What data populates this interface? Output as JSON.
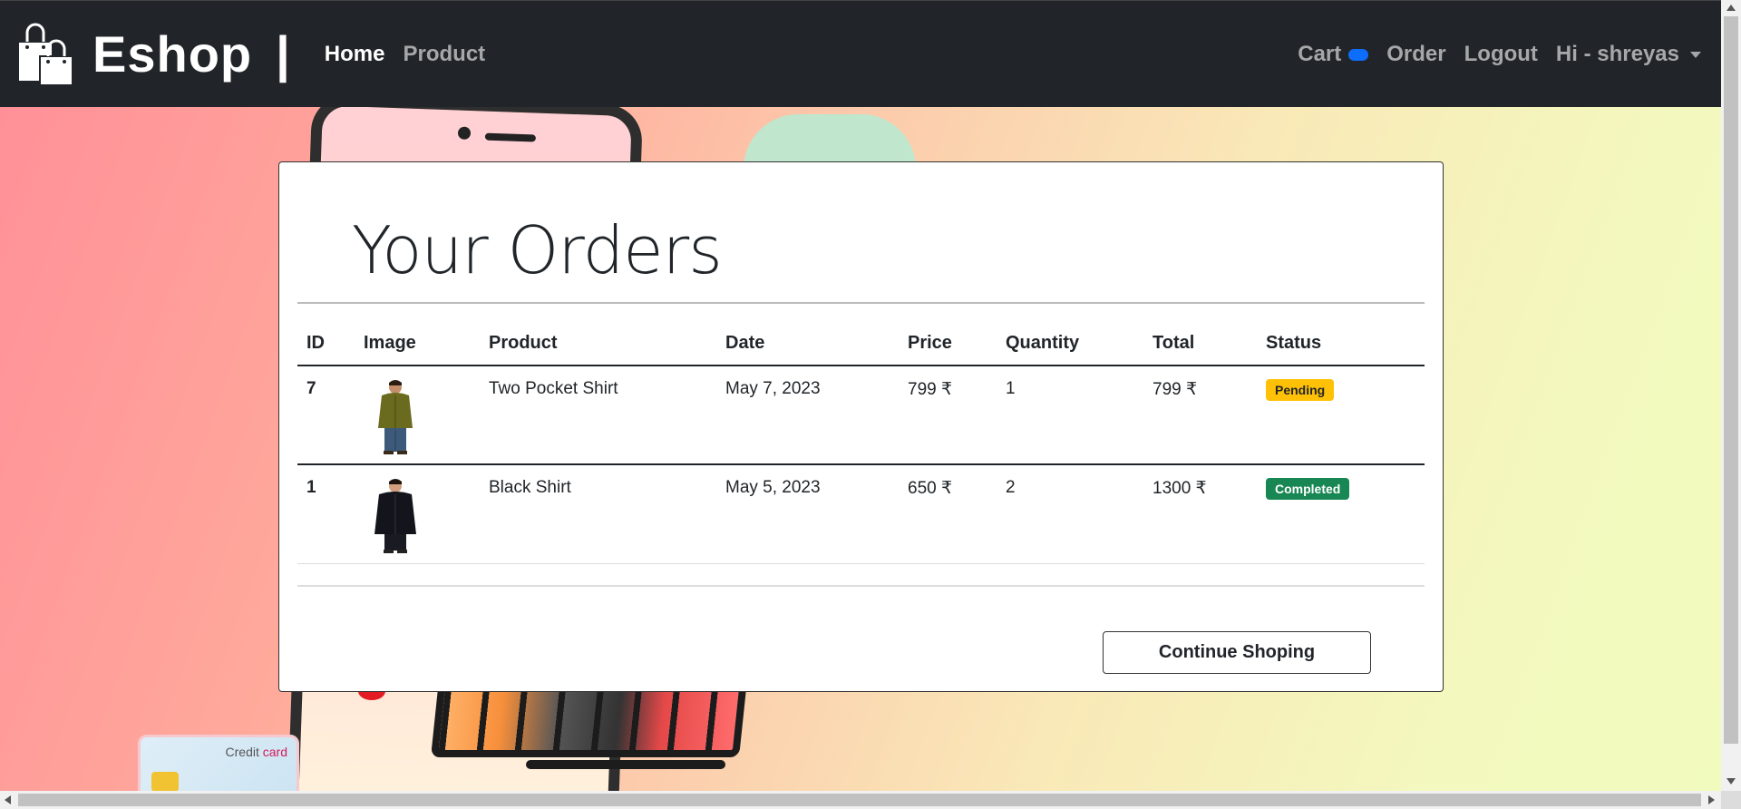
{
  "colors": {
    "navbar_bg": "#212529",
    "badge_pending": "#ffc107",
    "badge_completed": "#198754",
    "cart_badge": "#0d6efd"
  },
  "navbar": {
    "brand": "Eshop",
    "separator": "|",
    "links": [
      {
        "label": "Home",
        "active": true
      },
      {
        "label": "Product",
        "active": false
      }
    ],
    "right": {
      "cart": "Cart",
      "order": "Order",
      "logout": "Logout",
      "user": "Hi - shreyas"
    }
  },
  "orders": {
    "title": "Your Orders",
    "columns": [
      "ID",
      "Image",
      "Product",
      "Date",
      "Price",
      "Quantity",
      "Total",
      "Status"
    ],
    "rows": [
      {
        "id": "7",
        "image_icon": "olive-shirt-photo",
        "product": "Two Pocket Shirt",
        "date": "May 7, 2023",
        "price": "799 ₹",
        "quantity": "1",
        "total": "799 ₹",
        "status": "Pending"
      },
      {
        "id": "1",
        "image_icon": "black-shirt-photo",
        "product": "Black Shirt",
        "date": "May 5, 2023",
        "price": "650 ₹",
        "quantity": "2",
        "total": "1300 ₹",
        "status": "Completed"
      }
    ],
    "continue_label": "Continue Shoping"
  },
  "background": {
    "credit_card_text_1": "Credit",
    "credit_card_text_2": "card"
  }
}
